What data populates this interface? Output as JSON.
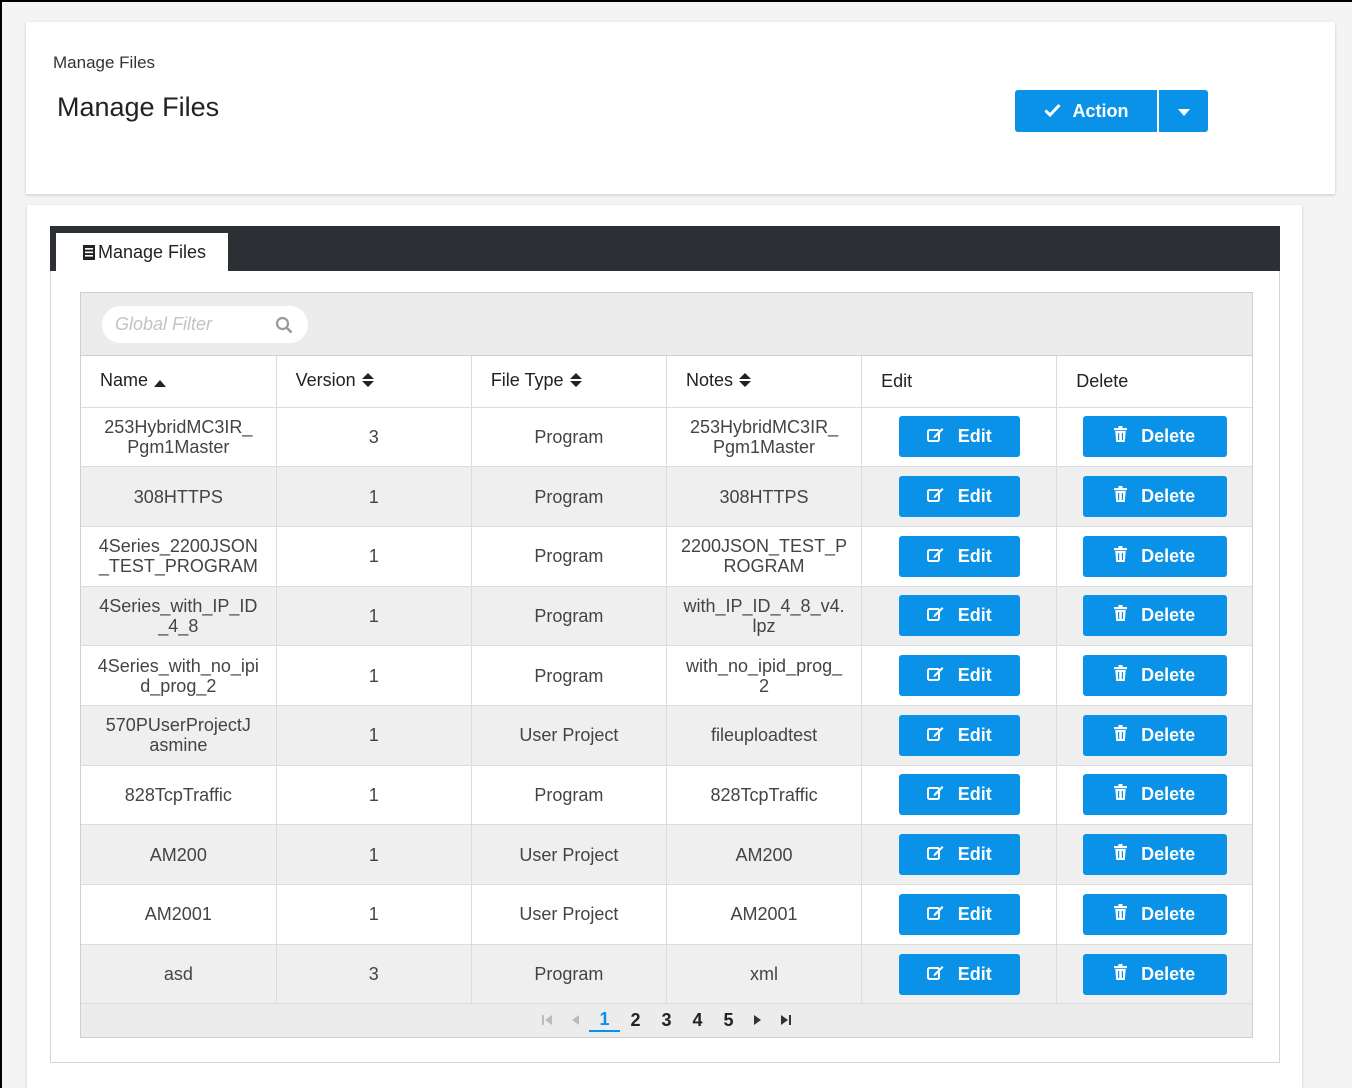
{
  "header": {
    "breadcrumb": "Manage Files",
    "title": "Manage Files",
    "action_label": "Action"
  },
  "tab": {
    "label": "Manage Files"
  },
  "filter": {
    "placeholder": "Global Filter"
  },
  "table": {
    "columns": [
      "Name",
      "Version",
      "File Type",
      "Notes",
      "Edit",
      "Delete"
    ],
    "sorted_column": "Name",
    "sort_direction": "ascending",
    "edit_label": "Edit",
    "delete_label": "Delete",
    "rows": [
      {
        "name": "253HybridMC3IR_\nPgm1Master",
        "version": "3",
        "type": "Program",
        "notes": "253HybridMC3IR_\nPgm1Master"
      },
      {
        "name": "308HTTPS",
        "version": "1",
        "type": "Program",
        "notes": "308HTTPS"
      },
      {
        "name": "4Series_2200JSON\n_TEST_PROGRAM",
        "version": "1",
        "type": "Program",
        "notes": "2200JSON_TEST_P\nROGRAM"
      },
      {
        "name": "4Series_with_IP_ID\n_4_8",
        "version": "1",
        "type": "Program",
        "notes": "with_IP_ID_4_8_v4.\nlpz"
      },
      {
        "name": "4Series_with_no_ipi\nd_prog_2",
        "version": "1",
        "type": "Program",
        "notes": "with_no_ipid_prog_\n2"
      },
      {
        "name": "570PUserProjectJ\nasmine",
        "version": "1",
        "type": "User Project",
        "notes": "fileuploadtest"
      },
      {
        "name": "828TcpTraffic",
        "version": "1",
        "type": "Program",
        "notes": "828TcpTraffic"
      },
      {
        "name": "AM200",
        "version": "1",
        "type": "User Project",
        "notes": "AM200"
      },
      {
        "name": "AM2001",
        "version": "1",
        "type": "User Project",
        "notes": "AM2001"
      },
      {
        "name": "asd",
        "version": "3",
        "type": "Program",
        "notes": "xml"
      }
    ]
  },
  "pagination": {
    "pages": [
      "1",
      "2",
      "3",
      "4",
      "5"
    ],
    "current": "1"
  },
  "colors": {
    "accent": "#0a91e8",
    "tab_bar": "#2c2f33",
    "row_alt": "#efefef"
  },
  "icons": {
    "action": "check-icon",
    "caret": "caret-down-icon",
    "tab": "document-icon",
    "filter": "search-icon",
    "sort_asc": "sort-asc-icon",
    "sort_both": "sort-both-icon",
    "edit": "edit-icon",
    "delete": "trash-icon"
  }
}
